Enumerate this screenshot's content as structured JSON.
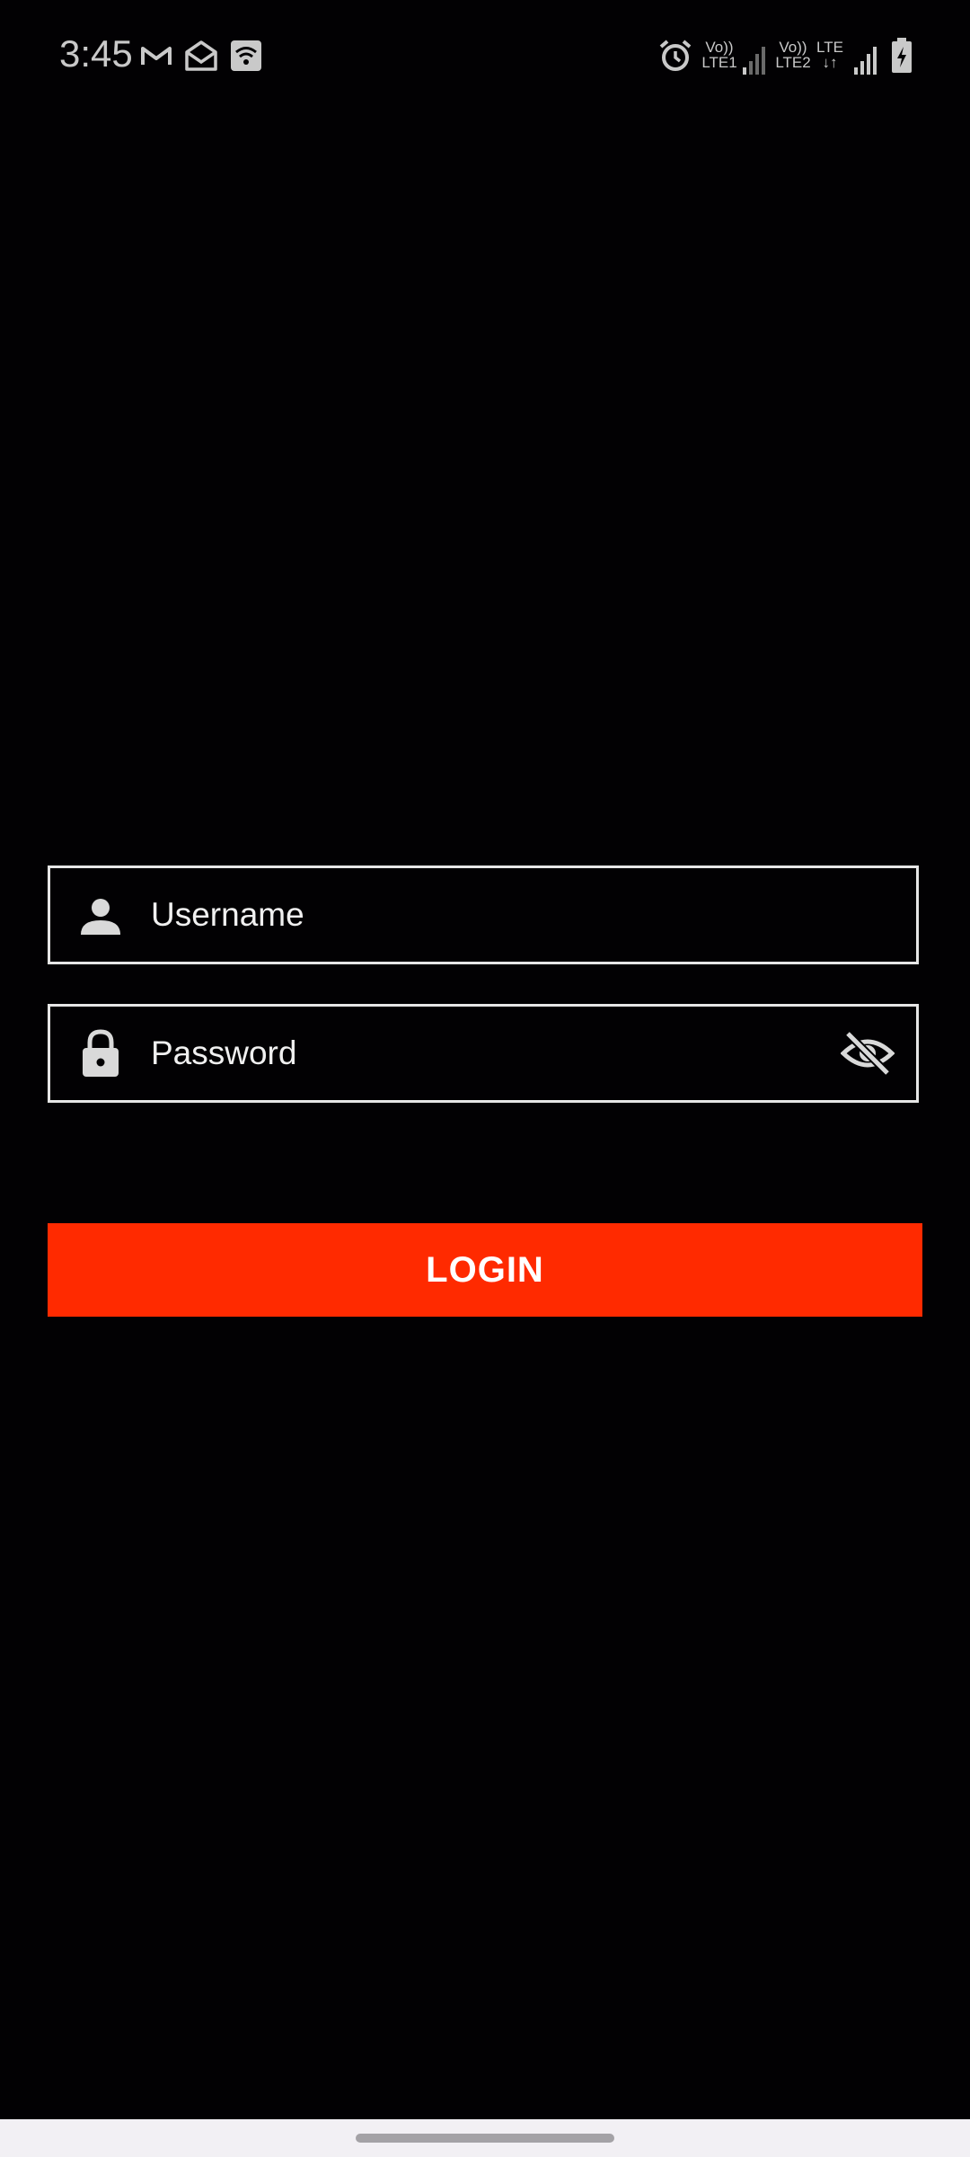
{
  "status_bar": {
    "time": "3:45",
    "sim1_volte": "Vo))",
    "sim1_lte": "LTE1",
    "sim2_volte": "Vo))",
    "sim2_lte": "LTE2",
    "data_type": "LTE",
    "icons": [
      "gmail-icon",
      "mail-open-icon",
      "wifi-icon",
      "alarm-icon",
      "signal-icon",
      "battery-charging-icon"
    ]
  },
  "login_form": {
    "username": {
      "placeholder": "Username",
      "icon": "person-icon"
    },
    "password": {
      "placeholder": "Password",
      "icon": "lock-icon",
      "toggle_icon": "eye-off-icon"
    },
    "login_label": "LOGIN"
  },
  "colors": {
    "background": "#020103",
    "accent": "#ff2a00",
    "field_border": "#e6e6e6",
    "nav_bar": "#f2f0f4"
  }
}
